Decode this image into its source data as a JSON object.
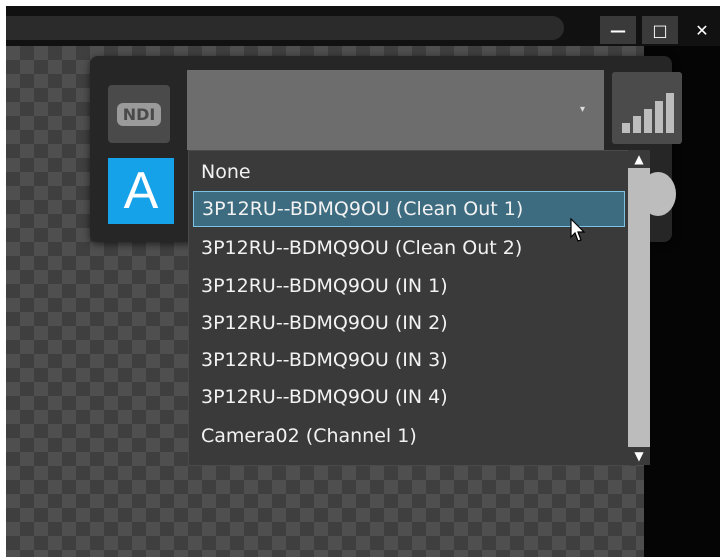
{
  "window": {
    "minimize_glyph": "—",
    "maximize_glyph": "□",
    "close_glyph": "✕"
  },
  "source_panel": {
    "ndi_badge_text": "NDI",
    "channel_label": "A",
    "dropdown_caret": "▾",
    "options": [
      "None",
      "3P12RU--BDMQ9OU (Clean Out 1)",
      "3P12RU--BDMQ9OU (Clean Out 2)",
      "3P12RU--BDMQ9OU (IN 1)",
      "3P12RU--BDMQ9OU (IN 2)",
      "3P12RU--BDMQ9OU (IN 3)",
      "3P12RU--BDMQ9OU (IN 4)",
      "Camera02 (Channel 1)"
    ],
    "highlighted_option": "3P12RU--BDMQ9OU (Clean Out 1)",
    "scroll_up_glyph": "▲",
    "scroll_down_glyph": "▼"
  },
  "colors": {
    "accent_blue": "#15a2e8",
    "selection_bg": "#3d6c80",
    "selection_border": "#7dc3e6"
  },
  "icons": [
    "signal-strength-icon",
    "globe-icon",
    "clock-icon",
    "mouse-cursor-icon"
  ]
}
